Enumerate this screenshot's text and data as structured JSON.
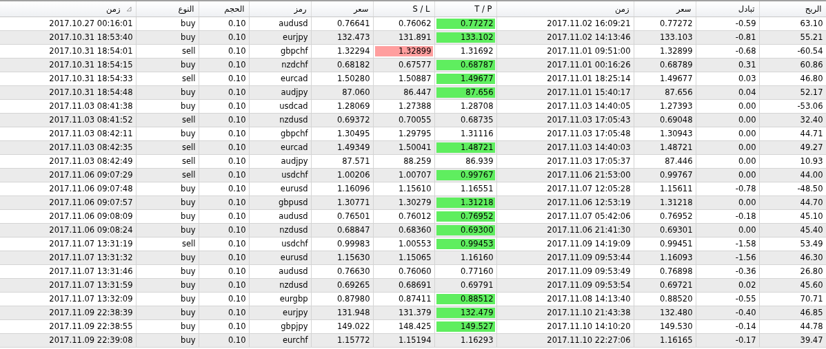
{
  "table": {
    "columns": [
      {
        "label": "زمن",
        "sorted": true
      },
      {
        "label": "النوع",
        "sorted": false
      },
      {
        "label": "الحجم",
        "sorted": false
      },
      {
        "label": "رمز",
        "sorted": false
      },
      {
        "label": "سعر",
        "sorted": false
      },
      {
        "label": "S / L",
        "sorted": false
      },
      {
        "label": "T / P",
        "sorted": false
      },
      {
        "label": "زمن",
        "sorted": false
      },
      {
        "label": "سعر",
        "sorted": false
      },
      {
        "label": "تبادل",
        "sorted": false
      },
      {
        "label": "الربح",
        "sorted": false
      }
    ],
    "rows": [
      {
        "cells": [
          "2017.10.27 00:16:01",
          "buy",
          "0.10",
          "audusd",
          "0.76641",
          "0.76062",
          "0.77272",
          "2017.11.02 16:09:21",
          "0.77272",
          "-0.59",
          "63.10"
        ],
        "sl_hit": false,
        "tp_hit": true
      },
      {
        "cells": [
          "2017.10.31 18:53:40",
          "buy",
          "0.10",
          "eurjpy",
          "132.473",
          "131.891",
          "133.102",
          "2017.11.02 14:13:46",
          "133.103",
          "-0.81",
          "55.21"
        ],
        "sl_hit": false,
        "tp_hit": true
      },
      {
        "cells": [
          "2017.10.31 18:54:01",
          "sell",
          "0.10",
          "gbpchf",
          "1.32294",
          "1.32899",
          "1.31692",
          "2017.11.01 09:51:00",
          "1.32899",
          "-0.68",
          "-60.54"
        ],
        "sl_hit": true,
        "tp_hit": false
      },
      {
        "cells": [
          "2017.10.31 18:54:15",
          "buy",
          "0.10",
          "nzdchf",
          "0.68182",
          "0.67577",
          "0.68787",
          "2017.11.01 00:16:26",
          "0.68789",
          "0.31",
          "60.86"
        ],
        "sl_hit": false,
        "tp_hit": true
      },
      {
        "cells": [
          "2017.10.31 18:54:33",
          "sell",
          "0.10",
          "eurcad",
          "1.50280",
          "1.50887",
          "1.49677",
          "2017.11.01 18:25:14",
          "1.49677",
          "0.03",
          "46.80"
        ],
        "sl_hit": false,
        "tp_hit": true
      },
      {
        "cells": [
          "2017.10.31 18:54:48",
          "buy",
          "0.10",
          "audjpy",
          "87.060",
          "86.447",
          "87.656",
          "2017.11.01 15:40:17",
          "87.656",
          "0.04",
          "52.17"
        ],
        "sl_hit": false,
        "tp_hit": true
      },
      {
        "cells": [
          "2017.11.03 08:41:38",
          "buy",
          "0.10",
          "usdcad",
          "1.28069",
          "1.27388",
          "1.28708",
          "2017.11.03 14:40:05",
          "1.27393",
          "0.00",
          "-53.06"
        ],
        "sl_hit": false,
        "tp_hit": false
      },
      {
        "cells": [
          "2017.11.03 08:41:52",
          "sell",
          "0.10",
          "nzdusd",
          "0.69372",
          "0.70055",
          "0.68735",
          "2017.11.03 17:05:43",
          "0.69048",
          "0.00",
          "32.40"
        ],
        "sl_hit": false,
        "tp_hit": false
      },
      {
        "cells": [
          "2017.11.03 08:42:11",
          "buy",
          "0.10",
          "gbpchf",
          "1.30495",
          "1.29795",
          "1.31116",
          "2017.11.03 17:05:48",
          "1.30943",
          "0.00",
          "44.71"
        ],
        "sl_hit": false,
        "tp_hit": false
      },
      {
        "cells": [
          "2017.11.03 08:42:35",
          "sell",
          "0.10",
          "eurcad",
          "1.49349",
          "1.50041",
          "1.48721",
          "2017.11.03 14:40:03",
          "1.48721",
          "0.00",
          "49.27"
        ],
        "sl_hit": false,
        "tp_hit": true
      },
      {
        "cells": [
          "2017.11.03 08:42:49",
          "sell",
          "0.10",
          "audjpy",
          "87.571",
          "88.259",
          "86.939",
          "2017.11.03 17:05:37",
          "87.446",
          "0.00",
          "10.93"
        ],
        "sl_hit": false,
        "tp_hit": false
      },
      {
        "cells": [
          "2017.11.06 09:07:29",
          "sell",
          "0.10",
          "usdchf",
          "1.00206",
          "1.00707",
          "0.99767",
          "2017.11.06 21:53:00",
          "0.99767",
          "0.00",
          "44.00"
        ],
        "sl_hit": false,
        "tp_hit": true
      },
      {
        "cells": [
          "2017.11.06 09:07:48",
          "buy",
          "0.10",
          "eurusd",
          "1.16096",
          "1.15610",
          "1.16551",
          "2017.11.07 12:05:28",
          "1.15611",
          "-0.78",
          "-48.50"
        ],
        "sl_hit": false,
        "tp_hit": false
      },
      {
        "cells": [
          "2017.11.06 09:07:57",
          "buy",
          "0.10",
          "gbpusd",
          "1.30771",
          "1.30279",
          "1.31218",
          "2017.11.06 12:53:19",
          "1.31218",
          "0.00",
          "44.70"
        ],
        "sl_hit": false,
        "tp_hit": true
      },
      {
        "cells": [
          "2017.11.06 09:08:09",
          "buy",
          "0.10",
          "audusd",
          "0.76501",
          "0.76012",
          "0.76952",
          "2017.11.07 05:42:06",
          "0.76952",
          "-0.18",
          "45.10"
        ],
        "sl_hit": false,
        "tp_hit": true
      },
      {
        "cells": [
          "2017.11.06 09:08:24",
          "buy",
          "0.10",
          "nzdusd",
          "0.68847",
          "0.68360",
          "0.69300",
          "2017.11.06 21:41:30",
          "0.69301",
          "0.00",
          "45.40"
        ],
        "sl_hit": false,
        "tp_hit": true
      },
      {
        "cells": [
          "2017.11.07 13:31:19",
          "sell",
          "0.10",
          "usdchf",
          "0.99983",
          "1.00553",
          "0.99453",
          "2017.11.09 14:19:09",
          "0.99451",
          "-1.58",
          "53.49"
        ],
        "sl_hit": false,
        "tp_hit": true
      },
      {
        "cells": [
          "2017.11.07 13:31:32",
          "buy",
          "0.10",
          "eurusd",
          "1.15630",
          "1.15065",
          "1.16160",
          "2017.11.09 09:53:44",
          "1.16093",
          "-1.56",
          "46.30"
        ],
        "sl_hit": false,
        "tp_hit": false
      },
      {
        "cells": [
          "2017.11.07 13:31:46",
          "buy",
          "0.10",
          "audusd",
          "0.76630",
          "0.76060",
          "0.77160",
          "2017.11.09 09:53:49",
          "0.76898",
          "-0.36",
          "26.80"
        ],
        "sl_hit": false,
        "tp_hit": false
      },
      {
        "cells": [
          "2017.11.07 13:31:59",
          "buy",
          "0.10",
          "nzdusd",
          "0.69265",
          "0.68691",
          "0.69791",
          "2017.11.09 09:53:54",
          "0.69721",
          "0.02",
          "45.60"
        ],
        "sl_hit": false,
        "tp_hit": false
      },
      {
        "cells": [
          "2017.11.07 13:32:09",
          "buy",
          "0.10",
          "eurgbp",
          "0.87980",
          "0.87411",
          "0.88512",
          "2017.11.08 14:13:40",
          "0.88520",
          "-0.55",
          "70.71"
        ],
        "sl_hit": false,
        "tp_hit": true
      },
      {
        "cells": [
          "2017.11.09 22:38:39",
          "buy",
          "0.10",
          "eurjpy",
          "131.948",
          "131.379",
          "132.479",
          "2017.11.10 21:43:38",
          "132.480",
          "-0.40",
          "46.85"
        ],
        "sl_hit": false,
        "tp_hit": true
      },
      {
        "cells": [
          "2017.11.09 22:38:55",
          "buy",
          "0.10",
          "gbpjpy",
          "149.022",
          "148.425",
          "149.527",
          "2017.11.10 14:10:20",
          "149.530",
          "-0.14",
          "44.78"
        ],
        "sl_hit": false,
        "tp_hit": true
      },
      {
        "cells": [
          "2017.11.09 22:39:08",
          "buy",
          "0.10",
          "eurchf",
          "1.15772",
          "1.15194",
          "1.16293",
          "2017.11.10 22:27:06",
          "1.16165",
          "-0.17",
          "39.47"
        ],
        "sl_hit": false,
        "tp_hit": false
      }
    ]
  }
}
